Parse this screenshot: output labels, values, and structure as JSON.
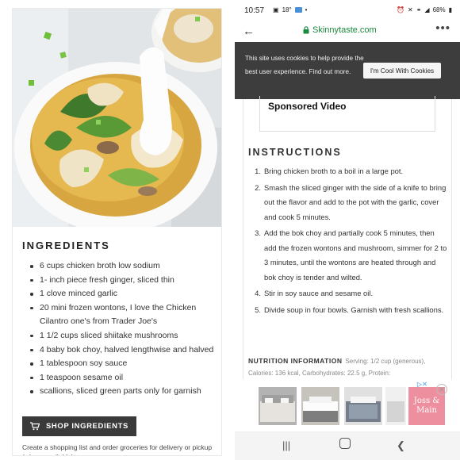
{
  "left": {
    "ingredients_title": "INGREDIENTS",
    "ingredients": [
      "6 cups chicken broth low sodium",
      "1- inch piece fresh ginger, sliced thin",
      "1 clove minced garlic",
      "20 mini frozen wontons, I love the Chicken Cilantro one's from Trader Joe's",
      "1 1/2 cups sliced shiitake mushrooms",
      "4 baby bok choy, halved lengthwise and halved",
      "1 tablespoon soy sauce",
      "1 teaspoon sesame oil",
      "scallions, sliced green parts only for garnish"
    ],
    "shop_button": "SHOP INGREDIENTS",
    "shop_note": "Create a shopping list and order groceries for delivery or pickup (where available)."
  },
  "phone": {
    "status": {
      "time": "10:57",
      "temp": "18°",
      "battery": "68%"
    },
    "url": "Skinnytaste.com",
    "cookie": {
      "text": "This site uses cookies to help provide the best user experience. Find out more.",
      "button": "I'm Cool With Cookies"
    },
    "sponsored_video": "Sponsored Video",
    "instructions_title": "INSTRUCTIONS",
    "steps": [
      {
        "num": "1.",
        "text": "Bring chicken broth to a boil in a large pot."
      },
      {
        "num": "2.",
        "text": "Smash the sliced ginger with the side of a knife to bring out the flavor and add to the pot with the garlic, cover and cook 5 minutes."
      },
      {
        "num": "3.",
        "text": "Add the bok choy and partially cook 5 minutes, then add the frozen wontons and mushroom, simmer for 2 to 3 minutes, until the wontons are heated through and bok choy is tender and wilted."
      },
      {
        "num": "4.",
        "text": "Stir in soy sauce and sesame oil."
      },
      {
        "num": "5.",
        "text": "Divide soup in four bowls. Garnish with fresh scallions."
      }
    ],
    "nutrition": {
      "title": "NUTRITION INFORMATION",
      "text": "Serving: 1/2 cup (generous), Calories: 136 kcal, Carbohydrates: 22.5 g, Protein:"
    },
    "ad": {
      "logo_line1": "Joss &",
      "logo_line2": "Main"
    }
  },
  "colors": {
    "url_green": "#1a8a3e",
    "cookie_bg": "#3d3d3d",
    "shop_button_bg": "#3a3a3a",
    "ad_logo_bg": "#e4546a"
  }
}
